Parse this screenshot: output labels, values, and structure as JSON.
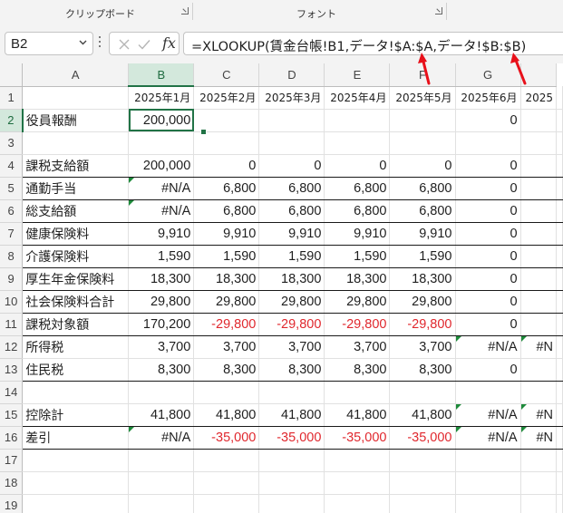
{
  "ribbon": {
    "groups": [
      {
        "label": "クリップボード"
      },
      {
        "label": "フォント"
      }
    ]
  },
  "formula_bar": {
    "name_box": "B2",
    "fx_label": "fx",
    "formula": "=XLOOKUP(賃金台帳!B1,データ!$A:$A,データ!$B:$B)"
  },
  "sheet": {
    "columns": [
      "A",
      "B",
      "C",
      "D",
      "E",
      "F",
      "G",
      "H"
    ],
    "active_column": "B",
    "active_row": 2,
    "header_row": [
      "",
      "2025年1月",
      "2025年2月",
      "2025年3月",
      "2025年4月",
      "2025年5月",
      "2025年6月",
      "2025"
    ],
    "rows": [
      {
        "num": "1",
        "cells": [
          "",
          "2025年1月",
          "2025年2月",
          "2025年3月",
          "2025年4月",
          "2025年5月",
          "2025年6月",
          "2025"
        ]
      },
      {
        "num": "2",
        "cells": [
          "役員報酬",
          "200,000",
          "",
          "",
          "",
          "",
          "0",
          ""
        ]
      },
      {
        "num": "3",
        "cells": [
          "",
          "",
          "",
          "",
          "",
          "",
          "",
          ""
        ]
      },
      {
        "num": "4",
        "cells": [
          "課税支給額",
          "200,000",
          "0",
          "0",
          "0",
          "0",
          "0",
          ""
        ]
      },
      {
        "num": "5",
        "cells": [
          "通勤手当",
          "#N/A",
          "6,800",
          "6,800",
          "6,800",
          "6,800",
          "0",
          ""
        ]
      },
      {
        "num": "6",
        "cells": [
          "総支給額",
          "#N/A",
          "6,800",
          "6,800",
          "6,800",
          "6,800",
          "0",
          ""
        ]
      },
      {
        "num": "7",
        "cells": [
          "健康保険料",
          "9,910",
          "9,910",
          "9,910",
          "9,910",
          "9,910",
          "0",
          ""
        ]
      },
      {
        "num": "8",
        "cells": [
          "介護保険料",
          "1,590",
          "1,590",
          "1,590",
          "1,590",
          "1,590",
          "0",
          ""
        ]
      },
      {
        "num": "9",
        "cells": [
          "厚生年金保険料",
          "18,300",
          "18,300",
          "18,300",
          "18,300",
          "18,300",
          "0",
          ""
        ]
      },
      {
        "num": "10",
        "cells": [
          "社会保険料合計",
          "29,800",
          "29,800",
          "29,800",
          "29,800",
          "29,800",
          "0",
          ""
        ]
      },
      {
        "num": "11",
        "cells": [
          "課税対象額",
          "170,200",
          "-29,800",
          "-29,800",
          "-29,800",
          "-29,800",
          "0",
          ""
        ]
      },
      {
        "num": "12",
        "cells": [
          "所得税",
          "3,700",
          "3,700",
          "3,700",
          "3,700",
          "3,700",
          "#N/A",
          "#N"
        ]
      },
      {
        "num": "13",
        "cells": [
          "住民税",
          "8,300",
          "8,300",
          "8,300",
          "8,300",
          "8,300",
          "0",
          ""
        ]
      },
      {
        "num": "14",
        "cells": [
          "",
          "",
          "",
          "",
          "",
          "",
          "",
          ""
        ]
      },
      {
        "num": "15",
        "cells": [
          "控除計",
          "41,800",
          "41,800",
          "41,800",
          "41,800",
          "41,800",
          "#N/A",
          "#N"
        ]
      },
      {
        "num": "16",
        "cells": [
          "差引",
          "#N/A",
          "-35,000",
          "-35,000",
          "-35,000",
          "-35,000",
          "#N/A",
          "#N"
        ]
      },
      {
        "num": "17",
        "cells": [
          "",
          "",
          "",
          "",
          "",
          "",
          "",
          ""
        ]
      },
      {
        "num": "18",
        "cells": [
          "",
          "",
          "",
          "",
          "",
          "",
          "",
          ""
        ]
      },
      {
        "num": "19",
        "cells": [
          "",
          "",
          "",
          "",
          "",
          "",
          "",
          ""
        ]
      }
    ]
  },
  "colors": {
    "accent_green": "#217346",
    "negative_red": "#e0282e",
    "arrow_red": "#e8101a",
    "error_indicator": "#1d8a3a"
  }
}
